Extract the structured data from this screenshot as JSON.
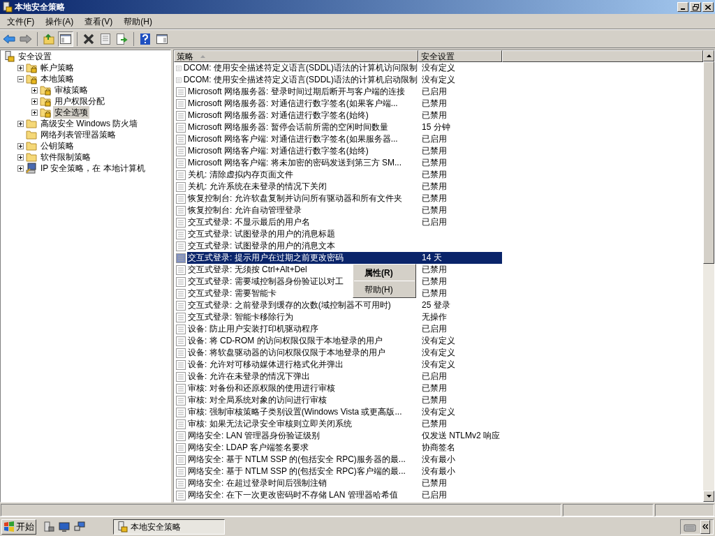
{
  "window": {
    "title": "本地安全策略"
  },
  "menu": [
    "文件(F)",
    "操作(A)",
    "查看(V)",
    "帮助(H)"
  ],
  "tree": [
    {
      "label": "安全设置",
      "selected": false,
      "children": [
        {
          "label": "帐户策略",
          "expanded": false,
          "selected": false
        },
        {
          "label": "本地策略",
          "expanded": true,
          "selected": false,
          "children": [
            {
              "label": "审核策略",
              "expanded": false,
              "selected": false
            },
            {
              "label": "用户权限分配",
              "expanded": false,
              "selected": false
            },
            {
              "label": "安全选项",
              "expanded": false,
              "selected": true
            }
          ]
        },
        {
          "label": "高级安全 Windows 防火墙",
          "expanded": false,
          "selected": false
        },
        {
          "label": "网络列表管理器策略",
          "selected": false
        },
        {
          "label": "公钥策略",
          "expanded": false,
          "selected": false
        },
        {
          "label": "软件限制策略",
          "expanded": false,
          "selected": false
        },
        {
          "label": "IP 安全策略，在 本地计算机",
          "expanded": false,
          "selected": false
        }
      ]
    }
  ],
  "table": {
    "columns": [
      "策略",
      "安全设置"
    ],
    "rows": [
      {
        "policy": "DCOM: 使用安全描述符定义语言(SDDL)语法的计算机访问限制",
        "setting": "没有定义",
        "selected": false
      },
      {
        "policy": "DCOM: 使用安全描述符定义语言(SDDL)语法的计算机启动限制",
        "setting": "没有定义",
        "selected": false
      },
      {
        "policy": "Microsoft 网络服务器: 登录时间过期后断开与客户端的连接",
        "setting": "已启用",
        "selected": false
      },
      {
        "policy": "Microsoft 网络服务器: 对通信进行数字签名(如果客户端...",
        "setting": "已禁用",
        "selected": false
      },
      {
        "policy": "Microsoft 网络服务器: 对通信进行数字签名(始终)",
        "setting": "已禁用",
        "selected": false
      },
      {
        "policy": "Microsoft 网络服务器: 暂停会话前所需的空闲时间数量",
        "setting": "15 分钟",
        "selected": false
      },
      {
        "policy": "Microsoft 网络客户端: 对通信进行数字签名(如果服务器...",
        "setting": "已启用",
        "selected": false
      },
      {
        "policy": "Microsoft 网络客户端: 对通信进行数字签名(始终)",
        "setting": "已禁用",
        "selected": false
      },
      {
        "policy": "Microsoft 网络客户端: 将未加密的密码发送到第三方 SM...",
        "setting": "已禁用",
        "selected": false
      },
      {
        "policy": "关机: 清除虚拟内存页面文件",
        "setting": "已禁用",
        "selected": false
      },
      {
        "policy": "关机: 允许系统在未登录的情况下关闭",
        "setting": "已禁用",
        "selected": false
      },
      {
        "policy": "恢复控制台: 允许软盘复制并访问所有驱动器和所有文件夹",
        "setting": "已禁用",
        "selected": false
      },
      {
        "policy": "恢复控制台: 允许自动管理登录",
        "setting": "已禁用",
        "selected": false
      },
      {
        "policy": "交互式登录: 不显示最后的用户名",
        "setting": "已启用",
        "selected": false
      },
      {
        "policy": "交互式登录: 试图登录的用户的消息标题",
        "selected": false
      },
      {
        "policy": "交互式登录: 试图登录的用户的消息文本",
        "selected": false
      },
      {
        "policy": "交互式登录: 提示用户在过期之前更改密码",
        "setting": "14 天",
        "selected": true
      },
      {
        "policy": "交互式登录: 无须按 Ctrl+Alt+Del",
        "setting": "已禁用",
        "selected": false
      },
      {
        "policy": "交互式登录: 需要域控制器身份验证以对工",
        "setting": "已禁用",
        "selected": false
      },
      {
        "policy": "交互式登录: 需要智能卡",
        "setting": "已禁用",
        "selected": false
      },
      {
        "policy": "交互式登录: 之前登录到缓存的次数(域控制器不可用时)",
        "setting": "25 登录",
        "selected": false
      },
      {
        "policy": "交互式登录: 智能卡移除行为",
        "setting": "无操作",
        "selected": false
      },
      {
        "policy": "设备: 防止用户安装打印机驱动程序",
        "setting": "已启用",
        "selected": false
      },
      {
        "policy": "设备: 将 CD-ROM 的访问权限仅限于本地登录的用户",
        "setting": "没有定义",
        "selected": false
      },
      {
        "policy": "设备: 将软盘驱动器的访问权限仅限于本地登录的用户",
        "setting": "没有定义",
        "selected": false
      },
      {
        "policy": "设备: 允许对可移动媒体进行格式化并弹出",
        "setting": "没有定义",
        "selected": false
      },
      {
        "policy": "设备: 允许在未登录的情况下弹出",
        "setting": "已启用",
        "selected": false
      },
      {
        "policy": "审核: 对备份和还原权限的使用进行审核",
        "setting": "已禁用",
        "selected": false
      },
      {
        "policy": "审核: 对全局系统对象的访问进行审核",
        "setting": "已禁用",
        "selected": false
      },
      {
        "policy": "审核: 强制审核策略子类别设置(Windows Vista 或更高版...",
        "setting": "没有定义",
        "selected": false
      },
      {
        "policy": "审核: 如果无法记录安全审核则立即关闭系统",
        "setting": "已禁用",
        "selected": false
      },
      {
        "policy": "网络安全: LAN 管理器身份验证级别",
        "setting": "仅发送 NTLMv2 响应",
        "selected": false
      },
      {
        "policy": "网络安全: LDAP 客户端签名要求",
        "setting": "协商签名",
        "selected": false
      },
      {
        "policy": "网络安全: 基于 NTLM SSP 的(包括安全 RPC)服务器的最...",
        "setting": "没有最小",
        "selected": false
      },
      {
        "policy": "网络安全: 基于 NTLM SSP 的(包括安全 RPC)客户端的最...",
        "setting": "没有最小",
        "selected": false
      },
      {
        "policy": "网络安全: 在超过登录时间后强制注销",
        "setting": "已禁用",
        "selected": false
      },
      {
        "policy": "网络安全: 在下一次更改密码时不存储 LAN 管理器哈希值",
        "setting": "已启用",
        "selected": false
      }
    ]
  },
  "context_menu": [
    {
      "label": "属性(R)",
      "kind": "default"
    },
    {
      "label": "帮助(H)",
      "kind": "normal"
    }
  ],
  "taskbar": {
    "start": "开始",
    "tasks": [
      "本地安全策略"
    ]
  }
}
